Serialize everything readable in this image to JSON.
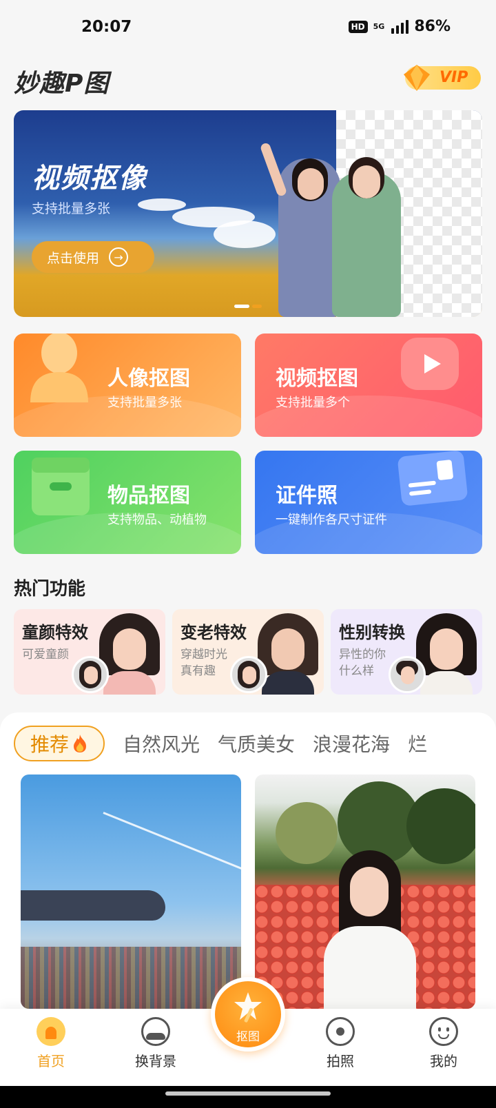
{
  "status_bar": {
    "time": "20:07",
    "hd": "HD",
    "network": "5G",
    "battery": "86%"
  },
  "header": {
    "logo": "妙趣P图",
    "vip": "VIP"
  },
  "banner": {
    "title": "视频抠像",
    "subtitle": "支持批量多张",
    "button_label": "点击使用"
  },
  "feature_cards": [
    {
      "title": "人像抠图",
      "subtitle": "支持批量多张",
      "icon": "person-icon"
    },
    {
      "title": "视频抠图",
      "subtitle": "支持批量多个",
      "icon": "play-icon"
    },
    {
      "title": "物品抠图",
      "subtitle": "支持物品、动植物",
      "icon": "box-icon"
    },
    {
      "title": "证件照",
      "subtitle": "一键制作各尺寸证件",
      "icon": "id-card-icon"
    }
  ],
  "hot": {
    "title": "热门功能",
    "items": [
      {
        "title": "童颜特效",
        "subtitle": "可爱童颜"
      },
      {
        "title": "变老特效",
        "subtitle": "穿越时光真有趣"
      },
      {
        "title": "性别转换",
        "subtitle": "异性的你什么样"
      }
    ]
  },
  "tabs": {
    "active": "推荐",
    "items": [
      "自然风光",
      "气质美女",
      "浪漫花海",
      "烂"
    ]
  },
  "bottom_nav": {
    "items": [
      {
        "label": "首页",
        "icon": "home-icon",
        "active": true
      },
      {
        "label": "换背景",
        "icon": "background-icon",
        "active": false
      },
      {
        "label": "拍照",
        "icon": "camera-icon",
        "active": false
      },
      {
        "label": "我的",
        "icon": "profile-icon",
        "active": false
      }
    ],
    "center_label": "抠图"
  },
  "colors": {
    "accent": "#f0a020",
    "background": "#f6f6f6"
  }
}
